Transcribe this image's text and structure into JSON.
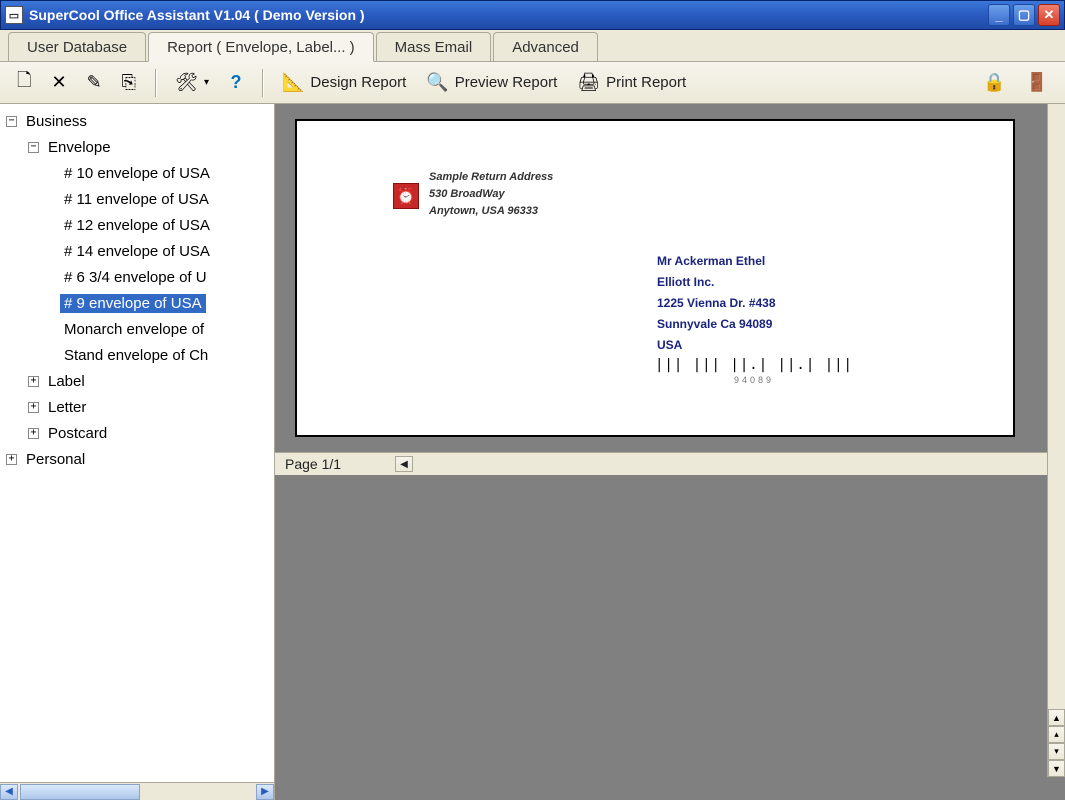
{
  "window": {
    "title": "SuperCool Office Assistant V1.04  ( Demo Version )"
  },
  "tabs": [
    {
      "label": "User Database"
    },
    {
      "label": "Report ( Envelope, Label... )"
    },
    {
      "label": "Mass Email"
    },
    {
      "label": "Advanced"
    }
  ],
  "toolbar": {
    "design": "Design Report",
    "preview": "Preview Report",
    "print": "Print Report"
  },
  "tree": {
    "business": "Business",
    "envelope": "Envelope",
    "env_items": [
      "# 10 envelope of USA",
      "# 11 envelope of USA",
      "# 12 envelope of USA",
      "# 14 envelope of USA",
      "# 6 3/4 envelope of U",
      "# 9 envelope of USA",
      "Monarch envelope of",
      "Stand envelope of Ch"
    ],
    "label": "Label",
    "letter": "Letter",
    "postcard": "Postcard",
    "personal": "Personal"
  },
  "envelope": {
    "return_addr": {
      "line1": "Sample Return Address",
      "line2": "530 BroadWay",
      "line3": "Anytown, USA 96333"
    },
    "recipient": {
      "line1": "Mr Ackerman Ethel",
      "line2": "Elliott Inc.",
      "line3": "1225 Vienna Dr. #438",
      "line4": "Sunnyvale Ca   94089",
      "line5": "USA"
    },
    "barcode": "||| ||| ||.| ||.| |||",
    "barcode_num": "94089"
  },
  "status": {
    "page": "Page 1/1"
  }
}
